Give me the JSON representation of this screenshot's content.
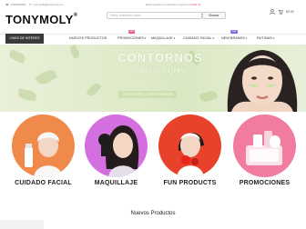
{
  "header": {
    "logo": "TONYMOLY",
    "phone": "2282828282",
    "email": "tony.molly@tonymoly.mx",
    "promo_text": "Envío gratis con compras mayores a",
    "promo_code": "$399.00",
    "search_placeholder": "Estoy buscando para...",
    "search_button": "Buscar",
    "cart_total": "$0.00"
  },
  "nav": {
    "brand_button": "LINKS DE INTERES",
    "items": [
      {
        "label": "NUEVOS PRODUCTOS",
        "badge": ""
      },
      {
        "label": "PROMOCIONES",
        "badge": "sale"
      },
      {
        "label": "MAQUILLAJE",
        "badge": ""
      },
      {
        "label": "CUIDADO FACIAL",
        "badge": ""
      },
      {
        "label": "NEW BRANDS",
        "badge": "new"
      },
      {
        "label": "RUTINAS",
        "badge": ""
      }
    ]
  },
  "banner": {
    "title": "CONTORNOS",
    "subtitle": "para ojos",
    "button": "CONOCER CONTORNOS"
  },
  "categories": [
    {
      "label": "CUIDADO FACIAL",
      "color": "#f08a4b"
    },
    {
      "label": "MAQUILLAJE",
      "color": "#d46fe0"
    },
    {
      "label": "FUN PRODUCTS",
      "color": "#e8432a"
    },
    {
      "label": "PROMOCIONES",
      "color": "#f27ca0"
    }
  ],
  "section": {
    "title": "Nuevos Productos"
  }
}
